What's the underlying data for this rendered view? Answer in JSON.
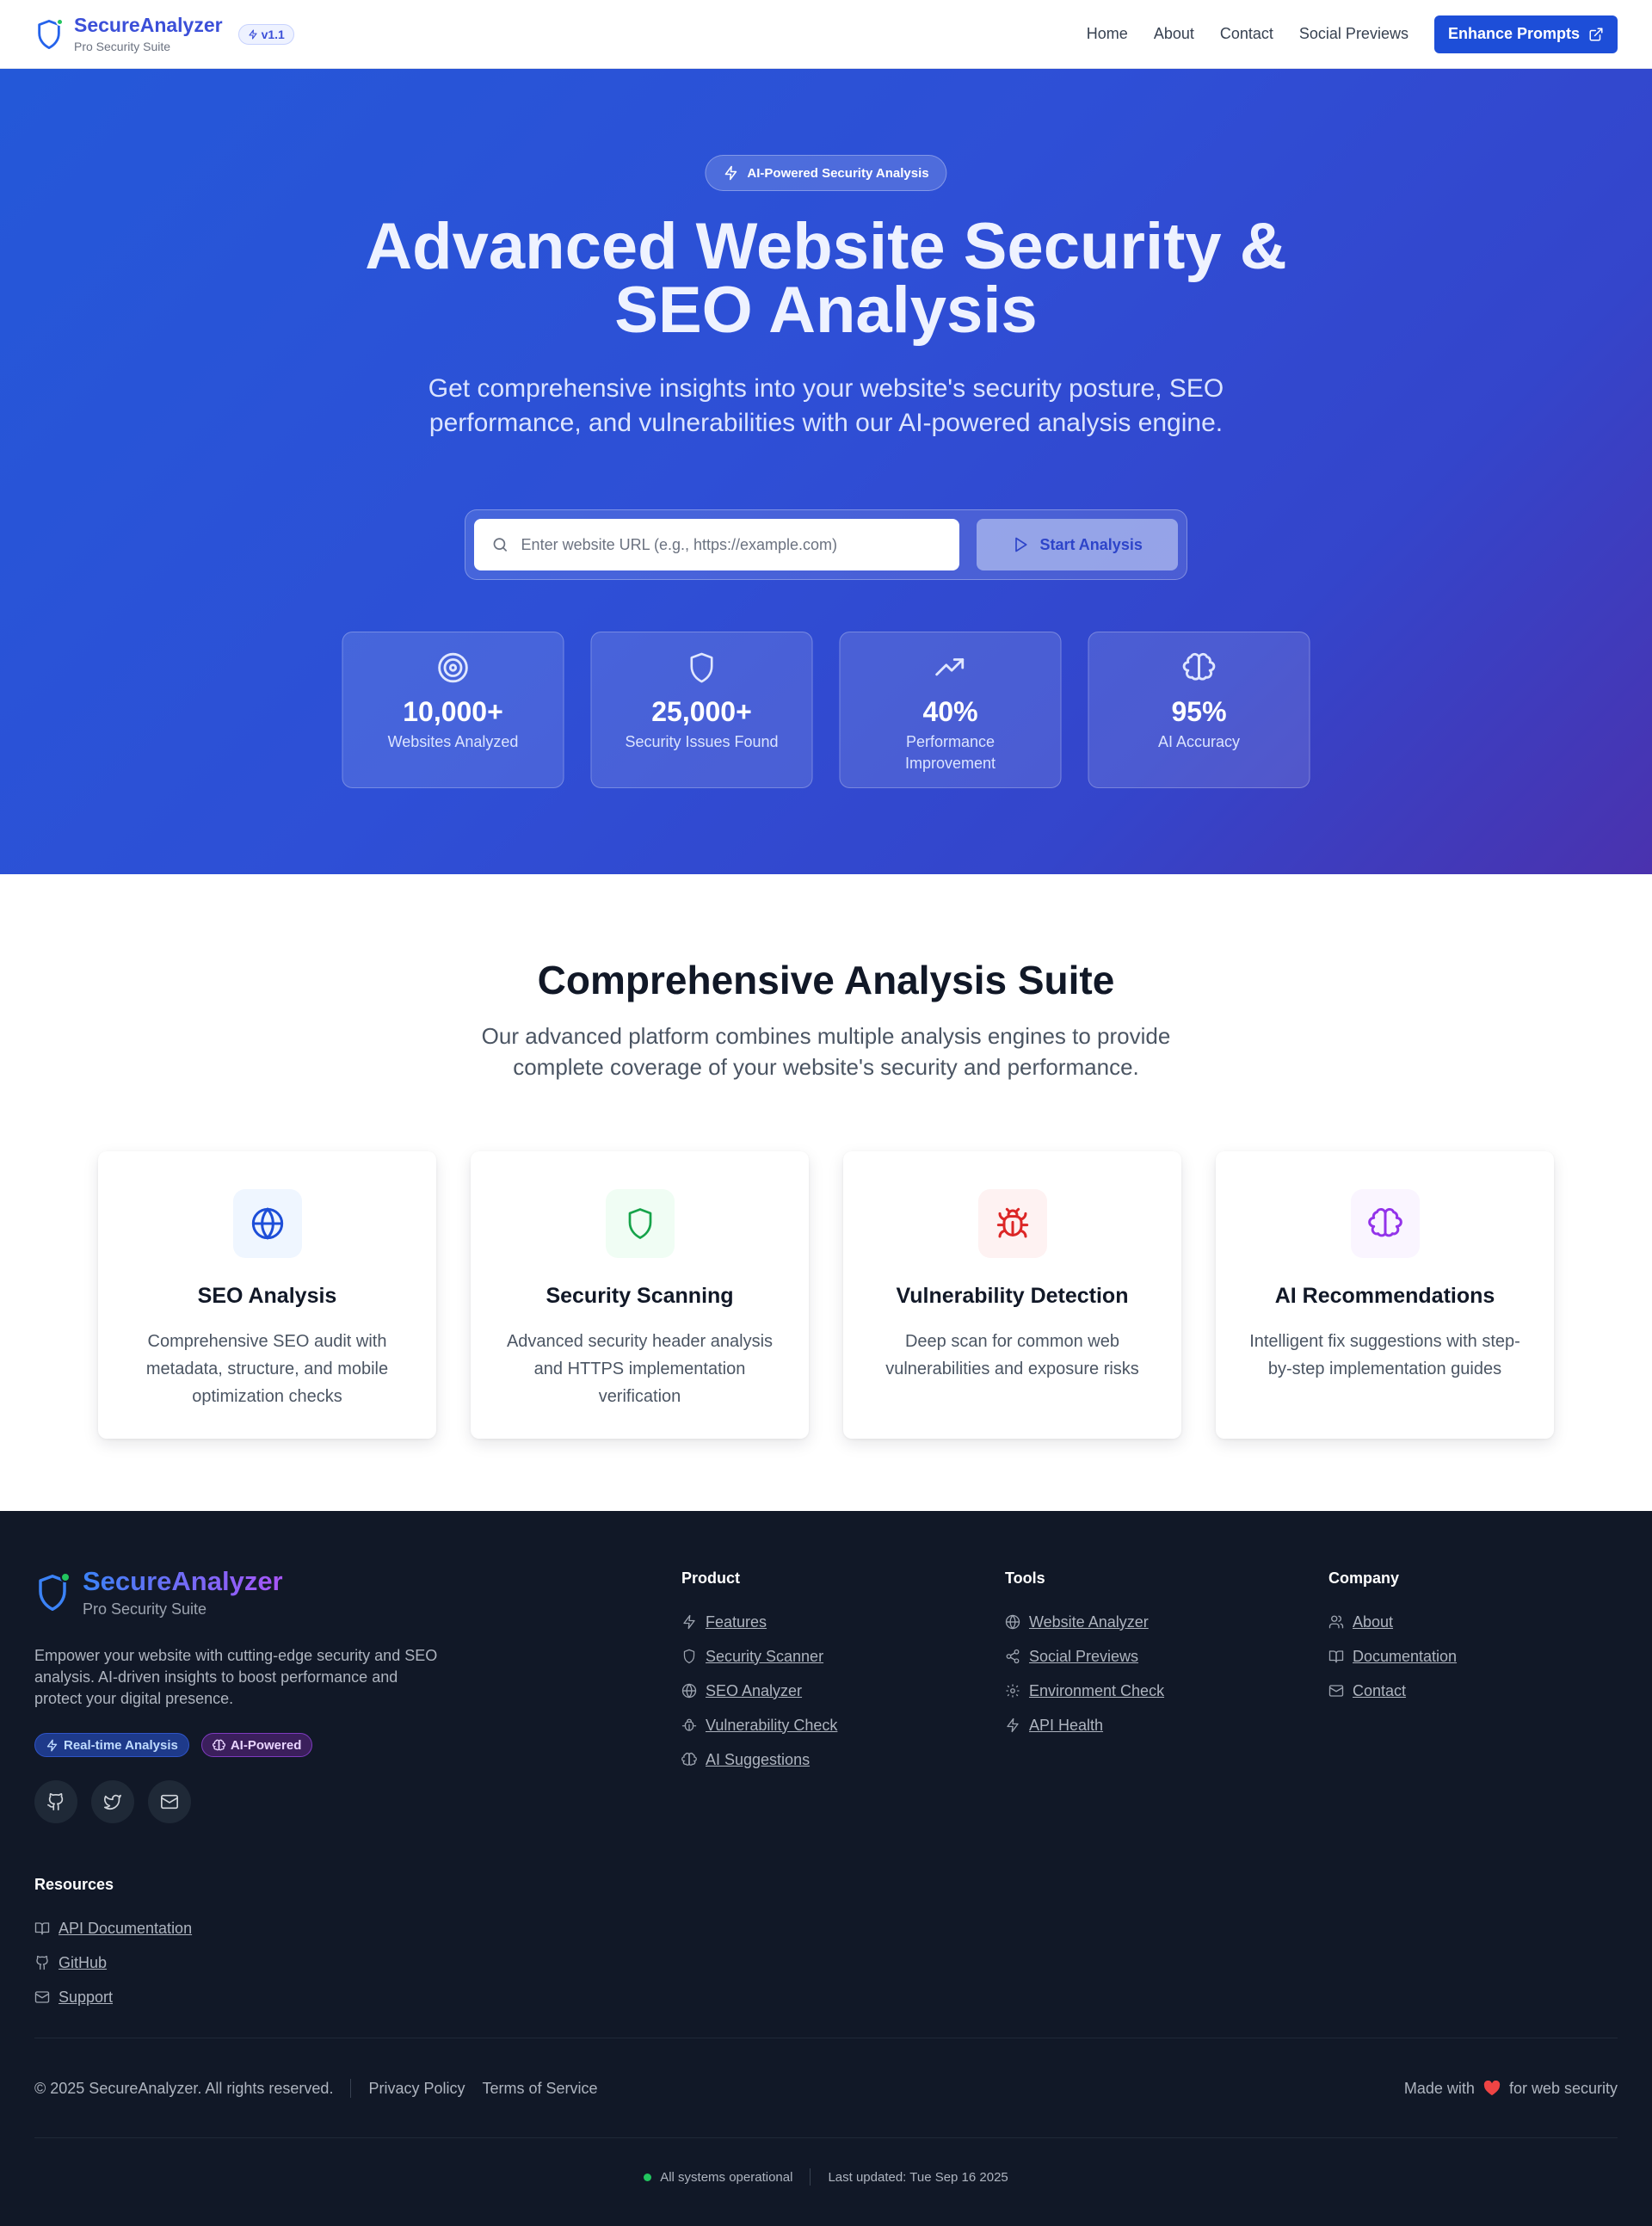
{
  "header": {
    "brand_name": "SecureAnalyzer",
    "brand_sub": "Pro Security Suite",
    "version": "v1.1",
    "nav": [
      "Home",
      "About",
      "Contact",
      "Social Previews"
    ],
    "cta_label": "Enhance Prompts"
  },
  "hero": {
    "pill": "AI-Powered Security Analysis",
    "title_line1": "Advanced Website Security &",
    "title_line2": "SEO Analysis",
    "subtitle": "Get comprehensive insights into your website's security posture, SEO performance, and vulnerabilities with our AI-powered analysis engine.",
    "search_placeholder": "Enter website URL (e.g., https://example.com)",
    "start_label": "Start Analysis",
    "stats": [
      {
        "icon": "target-icon",
        "value": "10,000+",
        "label": "Websites Analyzed"
      },
      {
        "icon": "shield-icon",
        "value": "25,000+",
        "label": "Security Issues Found"
      },
      {
        "icon": "trending-up-icon",
        "value": "40%",
        "label": "Performance Improvement"
      },
      {
        "icon": "brain-icon",
        "value": "95%",
        "label": "AI Accuracy"
      }
    ]
  },
  "suite": {
    "title": "Comprehensive Analysis Suite",
    "subtitle": "Our advanced platform combines multiple analysis engines to provide complete coverage of your website's security and performance.",
    "features": [
      {
        "icon": "globe-icon",
        "title": "SEO Analysis",
        "desc": "Comprehensive SEO audit with metadata, structure, and mobile optimization checks",
        "color": "#1d4ed8",
        "bg": "#eff6ff"
      },
      {
        "icon": "shield-icon",
        "title": "Security Scanning",
        "desc": "Advanced security header analysis and HTTPS implementation verification",
        "color": "#16a34a",
        "bg": "#f0fdf4"
      },
      {
        "icon": "bug-icon",
        "title": "Vulnerability Detection",
        "desc": "Deep scan for common web vulnerabilities and exposure risks",
        "color": "#dc2626",
        "bg": "#fef2f2"
      },
      {
        "icon": "brain-icon",
        "title": "AI Recommendations",
        "desc": "Intelligent fix suggestions with step-by-step implementation guides",
        "color": "#9333ea",
        "bg": "#faf5ff"
      }
    ]
  },
  "footer": {
    "brand_name": "SecureAnalyzer",
    "brand_sub": "Pro Security Suite",
    "description": "Empower your website with cutting-edge security and SEO analysis. AI-driven insights to boost performance and protect your digital presence.",
    "badges": [
      "Real-time Analysis",
      "AI-Powered"
    ],
    "socials": [
      "github-icon",
      "twitter-icon",
      "mail-icon"
    ],
    "resources_title": "Resources",
    "resources": [
      "API Documentation",
      "GitHub",
      "Support"
    ],
    "product_title": "Product",
    "product": [
      "Features",
      "Security Scanner",
      "SEO Analyzer",
      "Vulnerability Check",
      "AI Suggestions"
    ],
    "tools_title": "Tools",
    "tools": [
      "Website Analyzer",
      "Social Previews",
      "Environment Check",
      "API Health"
    ],
    "company_title": "Company",
    "company": [
      "About",
      "Documentation",
      "Contact"
    ],
    "copyright": "© 2025 SecureAnalyzer. All rights reserved.",
    "privacy": "Privacy Policy",
    "terms": "Terms of Service",
    "made_with": "Made with",
    "for_web": "for web security",
    "status": "All systems operational",
    "last_updated": "Last updated: Tue Sep 16 2025"
  }
}
